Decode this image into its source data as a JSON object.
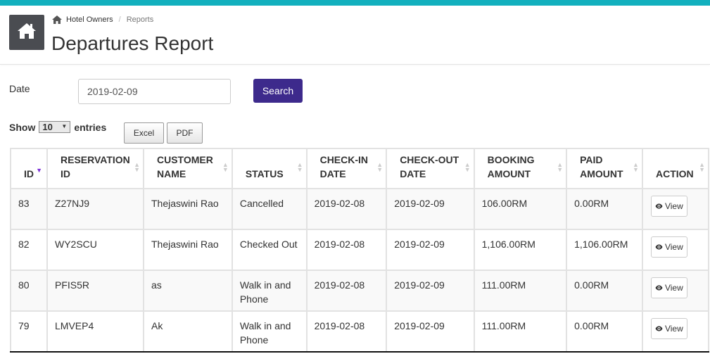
{
  "breadcrumb": {
    "home": "Hotel Owners",
    "current": "Reports"
  },
  "page_title": "Departures Report",
  "filter": {
    "date_label": "Date",
    "date_value": "2019-02-09",
    "search_label": "Search"
  },
  "show_entries": {
    "show": "Show",
    "value": "10",
    "entries": "entries"
  },
  "export": {
    "excel": "Excel",
    "pdf": "PDF"
  },
  "table": {
    "headers": [
      [
        "ID"
      ],
      [
        "RESERVATION",
        "ID"
      ],
      [
        "CUSTOMER",
        "NAME"
      ],
      [
        "STATUS"
      ],
      [
        "CHECK-IN",
        "DATE"
      ],
      [
        "CHECK-OUT",
        "DATE"
      ],
      [
        "BOOKING",
        "AMOUNT"
      ],
      [
        "PAID",
        "AMOUNT"
      ],
      [
        "ACTION"
      ]
    ],
    "rows": [
      {
        "id": "83",
        "reservation_id": "Z27NJ9",
        "customer": "Thejaswini Rao",
        "status": "Cancelled",
        "check_in": "2019-02-08",
        "check_out": "2019-02-09",
        "booking": "106.00RM",
        "paid": "0.00RM",
        "action": "View"
      },
      {
        "id": "82",
        "reservation_id": "WY2SCU",
        "customer": "Thejaswini Rao",
        "status": "Checked Out",
        "check_in": "2019-02-08",
        "check_out": "2019-02-09",
        "booking": "1,106.00RM",
        "paid": "1,106.00RM",
        "action": "View"
      },
      {
        "id": "80",
        "reservation_id": "PFIS5R",
        "customer": "as",
        "status": "Walk in and Phone",
        "check_in": "2019-02-08",
        "check_out": "2019-02-09",
        "booking": "111.00RM",
        "paid": "0.00RM",
        "action": "View"
      },
      {
        "id": "79",
        "reservation_id": "LMVEP4",
        "customer": "Ak",
        "status": "Walk in and Phone",
        "check_in": "2019-02-08",
        "check_out": "2019-02-09",
        "booking": "111.00RM",
        "paid": "0.00RM",
        "action": "View"
      }
    ]
  },
  "colors": {
    "topbar": "#12b0be",
    "search_button": "#3d2a8c",
    "sort_active": "#7b2fd6",
    "home_tile": "#4a4c51"
  },
  "icons": {
    "home_tile": "home-icon",
    "breadcrumb": "home-icon",
    "sort": "sort-icon",
    "view": "eye-icon"
  }
}
